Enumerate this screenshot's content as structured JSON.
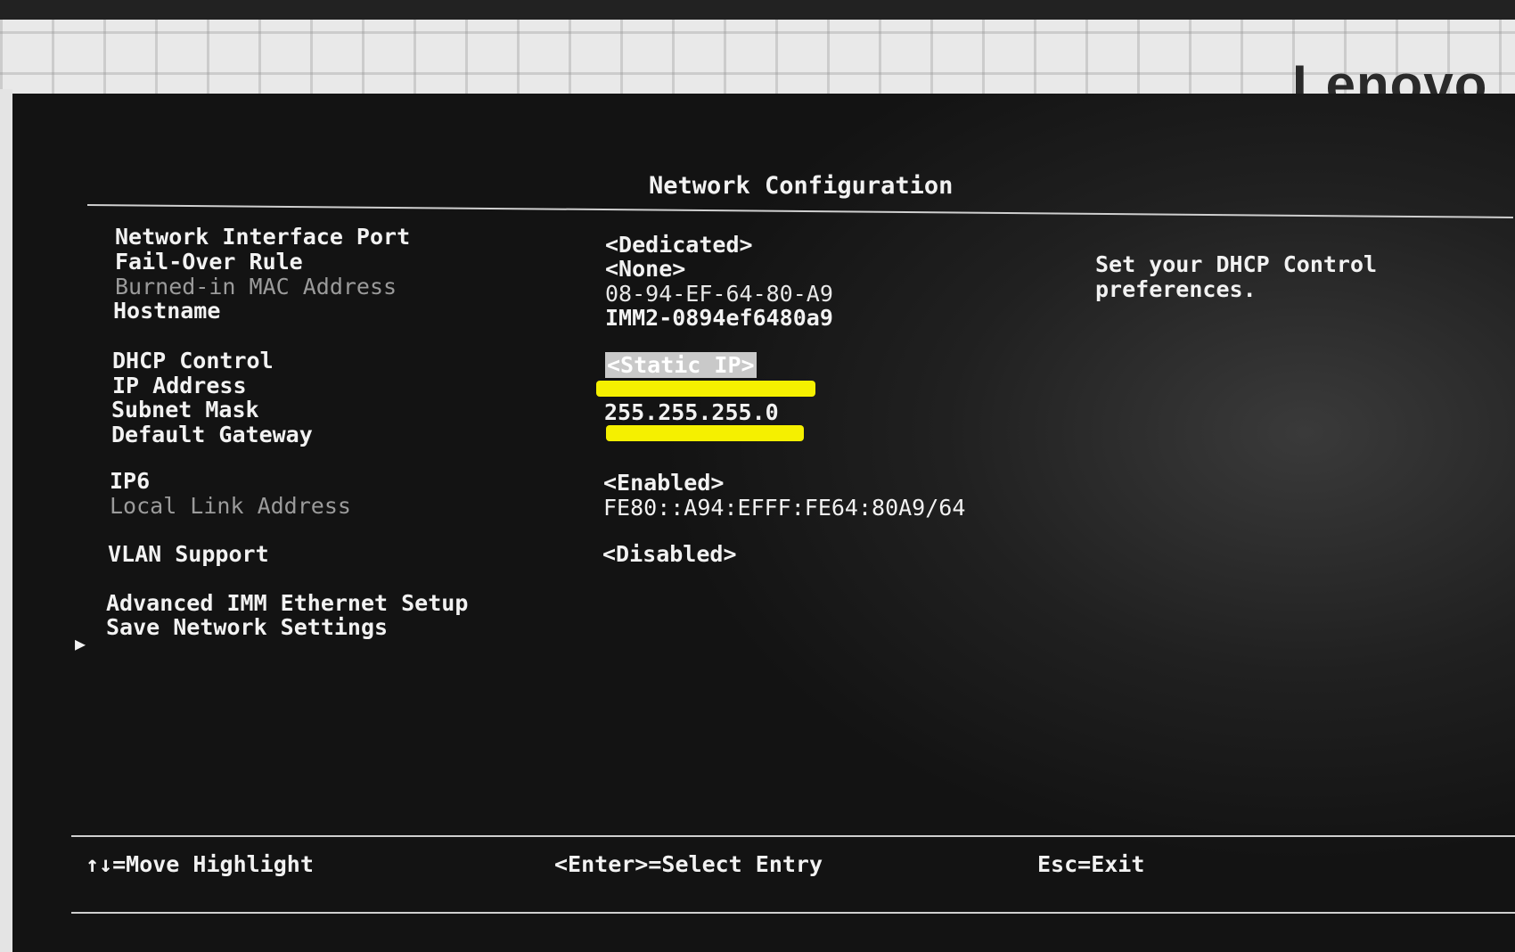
{
  "brand": "Lenovo",
  "screen": {
    "title": "Network Configuration",
    "settings": [
      {
        "label": "Network Interface Port",
        "value": "<Dedicated>"
      },
      {
        "label": "Fail-Over Rule",
        "value": "<None>"
      },
      {
        "label": "Burned-in MAC Address",
        "value": "08-94-EF-64-80-A9"
      },
      {
        "label": "Hostname",
        "value": "IMM2-0894ef6480a9"
      },
      {
        "label": "DHCP Control",
        "value": "<Static IP>"
      },
      {
        "label": "IP Address",
        "value": ""
      },
      {
        "label": "Subnet Mask",
        "value": "255.255.255.0"
      },
      {
        "label": "Default Gateway",
        "value": ""
      },
      {
        "label": "IP6",
        "value": "<Enabled>"
      },
      {
        "label": "Local Link Address",
        "value": "FE80::A94:EFFF:FE64:80A9/64"
      },
      {
        "label": "VLAN Support",
        "value": "<Disabled>"
      }
    ],
    "submenu": {
      "arrow": "▶",
      "label": "Advanced IMM Ethernet Setup"
    },
    "save_label": "Save Network Settings",
    "help_text": [
      "Set your DHCP Control",
      "preferences."
    ],
    "footer": {
      "move": "↑↓=Move Highlight",
      "select": "<Enter>=Select Entry",
      "exit": "Esc=Exit"
    },
    "redaction_color": "#f5f000",
    "highlight_color": "#c9c9c9"
  }
}
